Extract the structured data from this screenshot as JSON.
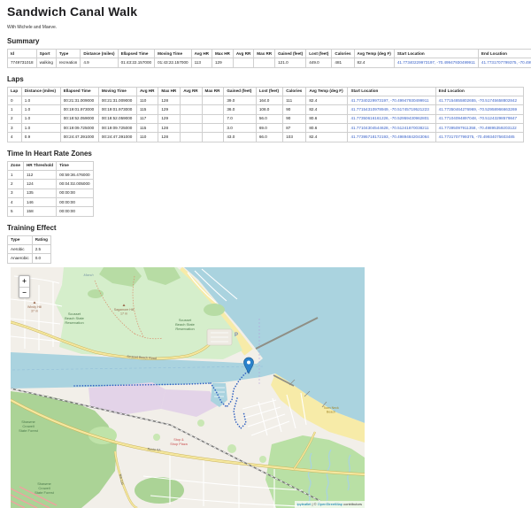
{
  "page": {
    "title": "Sandwich Canal Walk",
    "subtitle": "With Michele and Maeve."
  },
  "sections": {
    "summary": "Summary",
    "laps": "Laps",
    "hr_zones": "Time In Heart Rate Zones",
    "training_effect": "Training Effect"
  },
  "summary_table": {
    "headers": [
      "Id",
      "Sport",
      "Type",
      "Distance (miles)",
      "Ellapsed Time",
      "Moving Time",
      "Avg HR",
      "Max HR",
      "Avg RR",
      "Max RR",
      "Gained (feet)",
      "Lost (feet)",
      "Calories",
      "Avg Temp (deg F)",
      "Start Location",
      "End Location"
    ],
    "link_cols": [
      14,
      15
    ],
    "rows": [
      [
        "7749731018",
        "walking",
        "recreation",
        "4.9",
        "01:43:22.157000",
        "01:43:22.157000",
        "113",
        "129",
        "",
        "",
        "121.0",
        "449.0",
        "481",
        "82.4",
        "41.77340229973197, -70.49947930499911",
        "41.7731707799375, -70.49934075603485"
      ]
    ]
  },
  "laps_table": {
    "headers": [
      "Lap",
      "Distance (miles)",
      "Ellapsed Time",
      "Moving Time",
      "Avg HR",
      "Max HR",
      "Avg RR",
      "Max RR",
      "Gained (feet)",
      "Lost (feet)",
      "Calories",
      "Avg Temp (deg F)",
      "Start Location",
      "End Location"
    ],
    "link_cols": [
      12,
      13
    ],
    "rows": [
      [
        "0",
        "1.0",
        "00:21:31.009000",
        "00:21:31.009000",
        "110",
        "128",
        "",
        "",
        "39.0",
        "164.0",
        "111",
        "82.4",
        "41.77340229973197, -70.49947930499911",
        "41.77154855802655, -70.51745658802842"
      ],
      [
        "1",
        "1.0",
        "00:19:01.973000",
        "00:19:01.973000",
        "115",
        "129",
        "",
        "",
        "36.0",
        "108.0",
        "90",
        "82.4",
        "41.77154310978949, -70.51745719521223",
        "41.77350464276969, -70.52958966663269"
      ],
      [
        "2",
        "1.0",
        "00:18:52.059000",
        "00:18:52.059000",
        "117",
        "129",
        "",
        "",
        "7.0",
        "56.0",
        "90",
        "80.6",
        "41.77350616161226, -70.52959430962801",
        "41.77104094897048, -70.51243298579847"
      ],
      [
        "3",
        "1.0",
        "00:19:09.725000",
        "00:19:09.725000",
        "115",
        "128",
        "",
        "",
        "3.0",
        "69.0",
        "87",
        "80.6",
        "41.77104304544628, -70.51241870038211",
        "41.77395097911358, -70.49895359203122"
      ],
      [
        "4",
        "0.9",
        "00:24:47.391000",
        "00:24:47.391000",
        "110",
        "128",
        "",
        "",
        "43.0",
        "66.0",
        "103",
        "82.4",
        "41.77395718172193, -70.49894842043064",
        "41.7731707799375, -70.49934075603485"
      ]
    ]
  },
  "hr_zones_table": {
    "headers": [
      "Zone",
      "HR Threshold",
      "Time"
    ],
    "link_cols": [],
    "rows": [
      [
        "1",
        "112",
        "00:59:36.476000"
      ],
      [
        "2",
        "124",
        "00:04:02.005000"
      ],
      [
        "3",
        "135",
        "00:00:00"
      ],
      [
        "4",
        "146",
        "00:00:00"
      ],
      [
        "5",
        "158",
        "00:00:00"
      ]
    ]
  },
  "training_effect_table": {
    "headers": [
      "Type",
      "Rating"
    ],
    "link_cols": [],
    "rows": [
      [
        "Aerobic",
        "2.5"
      ],
      [
        "Anaerobic",
        "0.0"
      ]
    ]
  },
  "map": {
    "zoom_in": "+",
    "zoom_out": "−",
    "attribution": {
      "leaflet": "ipyleaflet",
      "sep": " | ",
      "copy": "© ",
      "osm": "OpenStreetMap",
      "rest": " contributors"
    },
    "labels": {
      "marsh": "Marsh",
      "reservation": [
        "Scusset",
        "Beach State",
        "Reservation"
      ],
      "sagamore": [
        "Sagamore Hill",
        "17 m"
      ],
      "windy": [
        "Windy Hill",
        "37 m"
      ],
      "scusset_road": "Scusset Beach Road",
      "route6a": "Route 6A",
      "ma130": "MA 130",
      "shawme": [
        "Shawme",
        "Crowell",
        "State Forest"
      ],
      "stop_shop": [
        "Stop &",
        "Shop Plaza"
      ],
      "town_neck": [
        "Town Neck",
        "Beach"
      ],
      "parking": "P"
    },
    "colors": {
      "land": "#f2efe9",
      "water": "#aad3df",
      "green_light": "#d5eecb",
      "green_forest": "#abd396",
      "sand": "#f7eba8",
      "road_yellow": "#f5e79e",
      "road_casing": "#c9b35a",
      "industrial": "#e3d3e8",
      "route_blue": "#3060c0",
      "marker_blue": "#2a81cb",
      "link_blue": "#3b63c9"
    }
  }
}
